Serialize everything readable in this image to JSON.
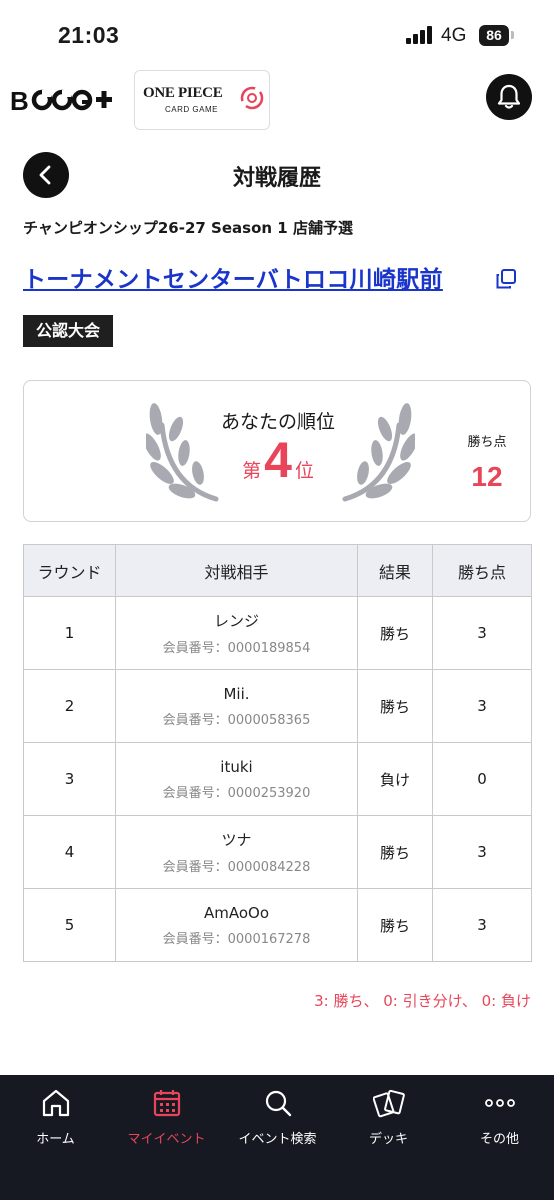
{
  "status_bar": {
    "time": "21:03",
    "network": "4G",
    "battery": "86"
  },
  "header": {
    "brand_logo_text": "B CGO +",
    "game_logo_title": "ONE PIECE",
    "game_logo_subtitle": "CARD GAME"
  },
  "page": {
    "title": "対戦履歴"
  },
  "event": {
    "name": "チャンピオンシップ26-27 Season 1 店舗予選",
    "store_name": "トーナメントセンターバトロコ川崎駅前",
    "badge": "公認大会"
  },
  "ranking": {
    "label": "あなたの順位",
    "prefix": "第",
    "rank": "4",
    "suffix": "位",
    "points_label": "勝ち点",
    "points": "12"
  },
  "table": {
    "headers": [
      "ラウンド",
      "対戦相手",
      "結果",
      "勝ち点"
    ],
    "id_prefix": "会員番号：",
    "rows": [
      {
        "round": "1",
        "opponent": "レンジ",
        "member_id": "0000189854",
        "result": "勝ち",
        "points": "3"
      },
      {
        "round": "2",
        "opponent": "Mii.",
        "member_id": "0000058365",
        "result": "勝ち",
        "points": "3"
      },
      {
        "round": "3",
        "opponent": "ituki",
        "member_id": "0000253920",
        "result": "負け",
        "points": "0"
      },
      {
        "round": "4",
        "opponent": "ツナ",
        "member_id": "0000084228",
        "result": "勝ち",
        "points": "3"
      },
      {
        "round": "5",
        "opponent": "AmAoOo",
        "member_id": "0000167278",
        "result": "勝ち",
        "points": "3"
      }
    ]
  },
  "legend": "3: 勝ち、 0: 引き分け、 0: 負け",
  "tabs": [
    {
      "label": "ホーム",
      "icon": "home-icon",
      "active": false
    },
    {
      "label": "マイイベント",
      "icon": "calendar-icon",
      "active": true
    },
    {
      "label": "イベント検索",
      "icon": "search-icon",
      "active": false
    },
    {
      "label": "デッキ",
      "icon": "cards-icon",
      "active": false
    },
    {
      "label": "その他",
      "icon": "more-icon",
      "active": false
    }
  ],
  "colors": {
    "accent": "#e8455a",
    "link": "#1a35c9",
    "tab_bar": "#161922",
    "header_cell": "#eceef4"
  }
}
